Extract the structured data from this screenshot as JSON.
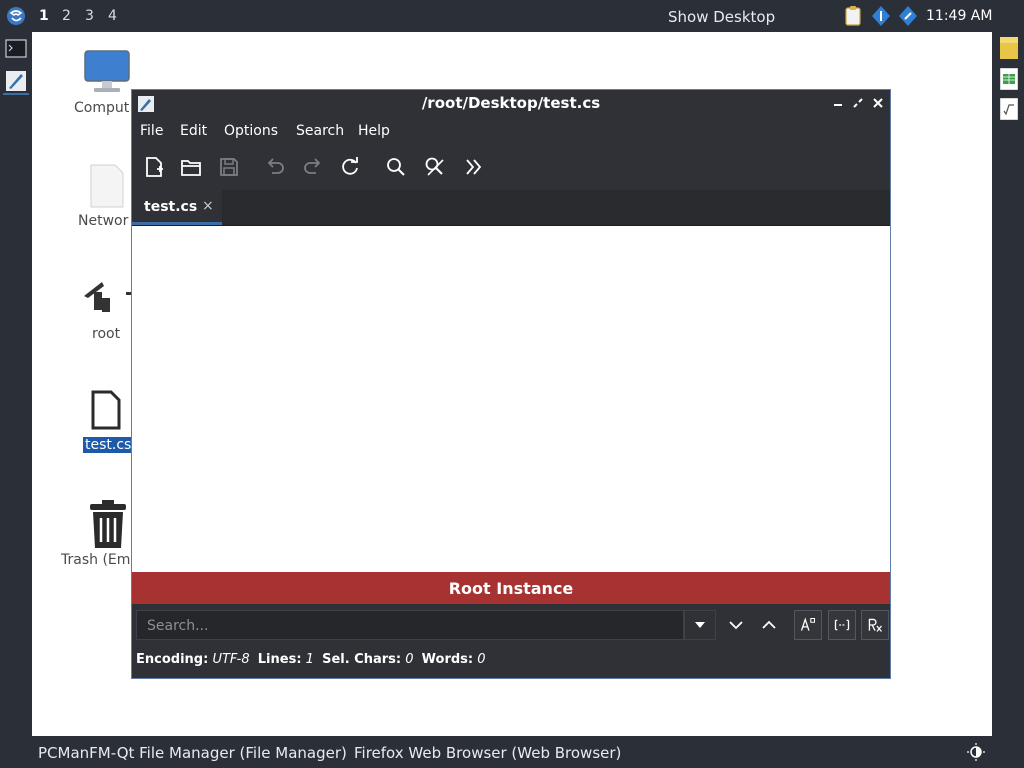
{
  "topbar": {
    "workspaces": [
      "1",
      "2",
      "3",
      "4"
    ],
    "show_desktop": "Show Desktop",
    "clock": "11:49 AM"
  },
  "desktop_icons": [
    {
      "label": "Comput",
      "icon": "computer-icon"
    },
    {
      "label": "Networ",
      "icon": "network-icon"
    },
    {
      "label": "root",
      "icon": "home-folder-icon"
    },
    {
      "label": "test.cs",
      "icon": "file-icon",
      "selected": true
    },
    {
      "label": "Trash (Em",
      "icon": "trash-icon"
    }
  ],
  "window": {
    "title": "/root/Desktop/test.cs",
    "menu": [
      "File",
      "Edit",
      "Options",
      "Search",
      "Help"
    ],
    "toolbar_icons": [
      "new-file-icon",
      "open-folder-icon",
      "save-icon",
      "undo-icon",
      "redo-icon",
      "reload-icon",
      "find-icon",
      "replace-icon",
      "more-icon"
    ],
    "tab": {
      "label": "test.cs",
      "close": "×"
    },
    "banner": "Root Instance",
    "search": {
      "placeholder": "Search..."
    },
    "status": {
      "encoding_label": "Encoding:",
      "encoding": "UTF-8",
      "lines_label": "Lines:",
      "lines": "1",
      "sel_label": "Sel. Chars:",
      "sel": "0",
      "words_label": "Words:",
      "words": "0"
    }
  },
  "taskbar": {
    "items": [
      "PCManFM-Qt File Manager (File Manager)",
      "Firefox Web Browser (Web Browser)"
    ]
  },
  "colors": {
    "panel": "#2b2f38",
    "window_bg": "#2f3137",
    "accent": "#3a6ea5",
    "root_banner": "#a63232",
    "selection": "#1e5aa8"
  }
}
